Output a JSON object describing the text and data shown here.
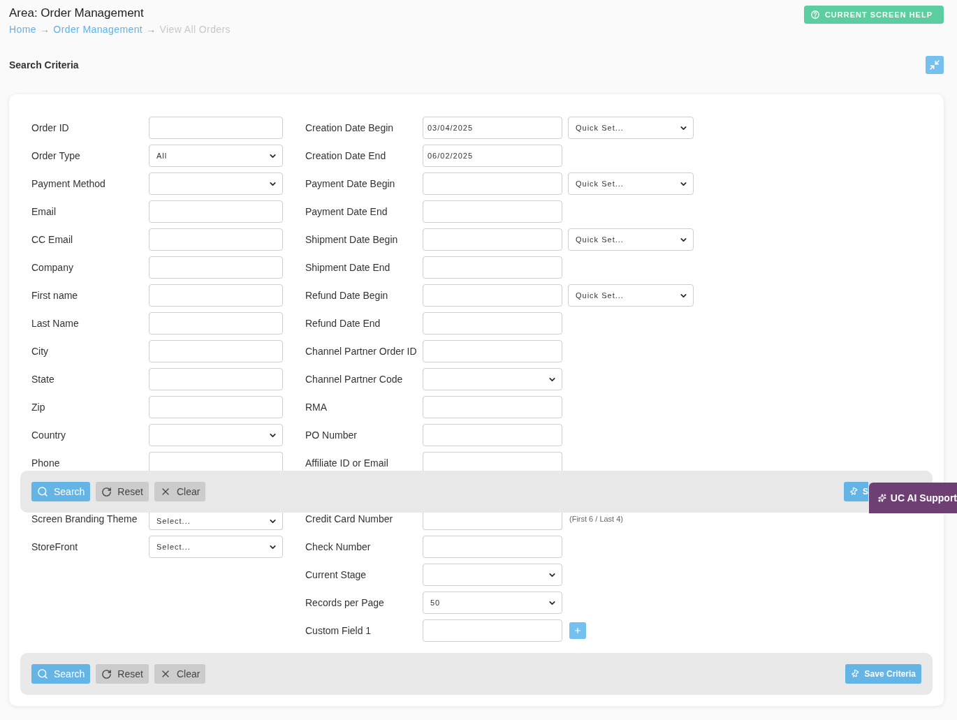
{
  "header": {
    "title": "Area: Order Management",
    "breadcrumb": [
      {
        "label": "Home",
        "kind": "link"
      },
      {
        "label": "→",
        "kind": "separator"
      },
      {
        "label": "Order Management",
        "kind": "link"
      },
      {
        "label": "→",
        "kind": "separator"
      },
      {
        "label": "View All Orders",
        "kind": "current"
      }
    ],
    "help_button": {
      "label": "CURRENT SCREEN HELP"
    }
  },
  "section": {
    "title": "Search Criteria"
  },
  "left_fields": [
    {
      "label": "Order ID",
      "kind": "text"
    },
    {
      "label": "Order Type",
      "kind": "select",
      "value": "All"
    },
    {
      "label": "Payment Method",
      "kind": "select"
    },
    {
      "label": "Email",
      "kind": "text"
    },
    {
      "label": "CC Email",
      "kind": "text"
    },
    {
      "label": "Company",
      "kind": "text"
    },
    {
      "label": "First name",
      "kind": "text"
    },
    {
      "label": "Last Name",
      "kind": "text"
    },
    {
      "label": "City",
      "kind": "text"
    },
    {
      "label": "State",
      "kind": "text"
    },
    {
      "label": "Zip",
      "kind": "text"
    },
    {
      "label": "Country",
      "kind": "select"
    },
    {
      "label": "Phone",
      "kind": "text"
    },
    {
      "label": "Screen Branding Theme",
      "kind": "select",
      "value": "Select..."
    },
    {
      "label": "StoreFront",
      "kind": "select",
      "value": "Select..."
    }
  ],
  "right_fields": [
    {
      "label": "Creation Date Begin",
      "kind": "text",
      "value": "03/04/2025",
      "quick_set": "Quick Set..."
    },
    {
      "label": "Creation Date End",
      "kind": "text",
      "value": "06/02/2025"
    },
    {
      "label": "Payment Date Begin",
      "kind": "text",
      "quick_set": "Quick Set..."
    },
    {
      "label": "Payment Date End",
      "kind": "text"
    },
    {
      "label": "Shipment Date Begin",
      "kind": "text",
      "quick_set": "Quick Set..."
    },
    {
      "label": "Shipment Date End",
      "kind": "text"
    },
    {
      "label": "Refund Date Begin",
      "kind": "text",
      "quick_set": "Quick Set..."
    },
    {
      "label": "Refund Date End",
      "kind": "text"
    },
    {
      "label": "Channel Partner Order ID",
      "kind": "text"
    },
    {
      "label": "Channel Partner Code",
      "kind": "select"
    },
    {
      "label": "RMA",
      "kind": "text"
    },
    {
      "label": "PO Number",
      "kind": "text"
    },
    {
      "label": "Affiliate ID or Email",
      "kind": "text"
    },
    {
      "label": "Credit Card Number",
      "kind": "text",
      "note": "(First 6 / Last 4)"
    },
    {
      "label": "Check Number",
      "kind": "text"
    },
    {
      "label": "Current Stage",
      "kind": "select"
    },
    {
      "label": "Records per Page",
      "kind": "select",
      "value": "50"
    },
    {
      "label": "Custom Field 1",
      "kind": "text",
      "add_button": true
    }
  ],
  "sticky_actions": {
    "buttons": [
      {
        "label": "Search",
        "kind": "search"
      },
      {
        "label": "Reset",
        "kind": "reset"
      },
      {
        "label": "Clear",
        "kind": "clear"
      }
    ],
    "save_button": {
      "label": "S"
    }
  },
  "bottom_actions": {
    "buttons": [
      {
        "label": "Search",
        "kind": "search"
      },
      {
        "label": "Reset",
        "kind": "reset"
      },
      {
        "label": "Clear",
        "kind": "clear"
      }
    ],
    "save_button": {
      "label": "Save Criteria"
    }
  },
  "support_tab": {
    "label": "UC AI Support"
  }
}
